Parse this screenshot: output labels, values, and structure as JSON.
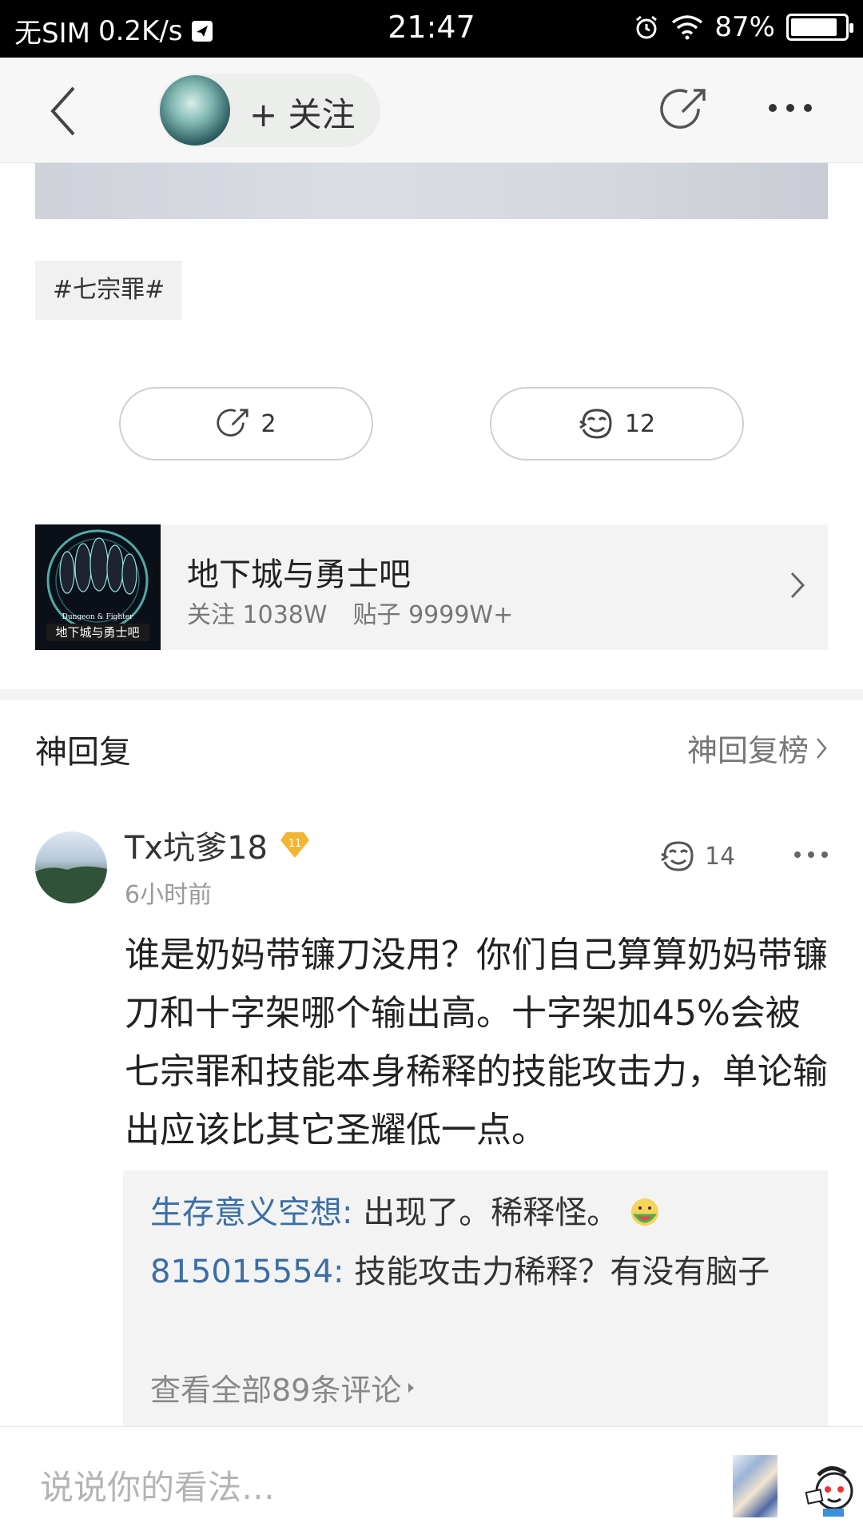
{
  "status_bar": {
    "carrier": "无SIM",
    "speed": "0.2K/s",
    "time": "21:47",
    "battery": "87%",
    "battery_level": 0.87
  },
  "nav": {
    "follow_label": "+ 关注"
  },
  "post": {
    "tag": "#七宗罪#",
    "share_count": "2",
    "like_count": "12"
  },
  "forum": {
    "name": "地下城与勇士吧",
    "follow": "关注 1038W",
    "posts": "贴子 9999W+"
  },
  "hot_replies": {
    "title": "神回复",
    "ranking_link": "神回复榜"
  },
  "comment": {
    "username": "Tx坑爹18",
    "level": "11",
    "time": "6小时前",
    "like_count": "14",
    "text": "谁是奶妈带镰刀没用？你们自己算算奶妈带镰刀和十字架哪个输出高。十字架加45%会被七宗罪和技能本身稀释的技能攻击力，单论输出应该比其它圣耀低一点。",
    "replies": [
      {
        "name": "生存意义空想:",
        "text": "出现了。稀释怪。"
      },
      {
        "name": "815015554:",
        "text": "技能攻击力稀释？有没有脑子"
      }
    ],
    "view_all": "查看全部89条评论"
  },
  "bottom_bar": {
    "input_placeholder": "说说你的看法…"
  }
}
